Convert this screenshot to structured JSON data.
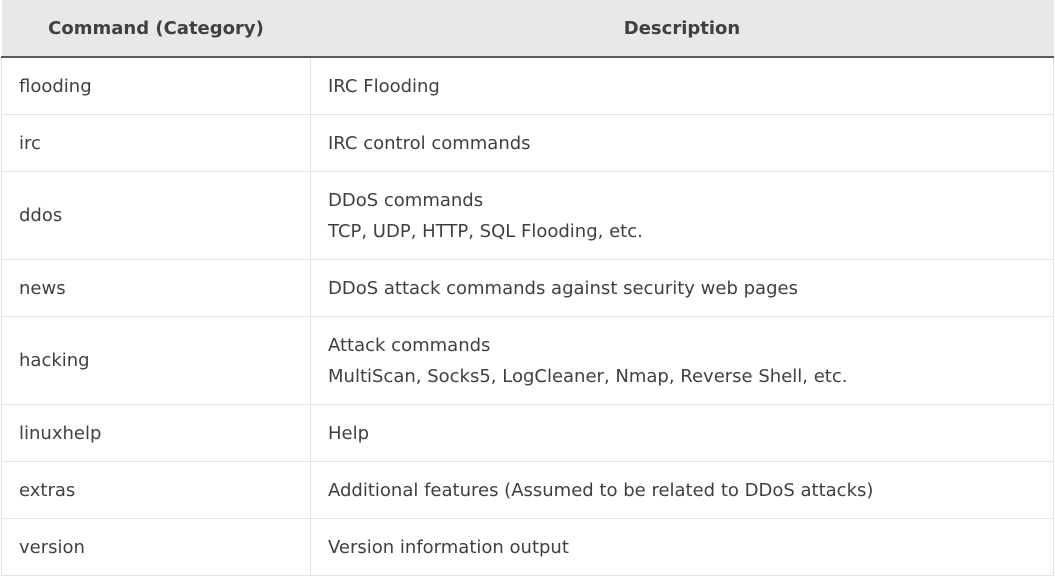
{
  "headers": {
    "command": "Command (Category)",
    "description": "Description"
  },
  "rows": [
    {
      "command": "flooding",
      "description": [
        "IRC Flooding"
      ]
    },
    {
      "command": "irc",
      "description": [
        "IRC control commands"
      ]
    },
    {
      "command": "ddos",
      "description": [
        "DDoS commands",
        "TCP, UDP, HTTP, SQL Flooding, etc."
      ]
    },
    {
      "command": "news",
      "description": [
        "DDoS attack commands against security web pages"
      ]
    },
    {
      "command": "hacking",
      "description": [
        "Attack commands",
        "MultiScan, Socks5, LogCleaner, Nmap, Reverse Shell, etc."
      ]
    },
    {
      "command": "linuxhelp",
      "description": [
        "Help"
      ]
    },
    {
      "command": "extras",
      "description": [
        "Additional features (Assumed to be related to DDoS attacks)"
      ]
    },
    {
      "command": "version",
      "description": [
        "Version information output"
      ]
    }
  ]
}
